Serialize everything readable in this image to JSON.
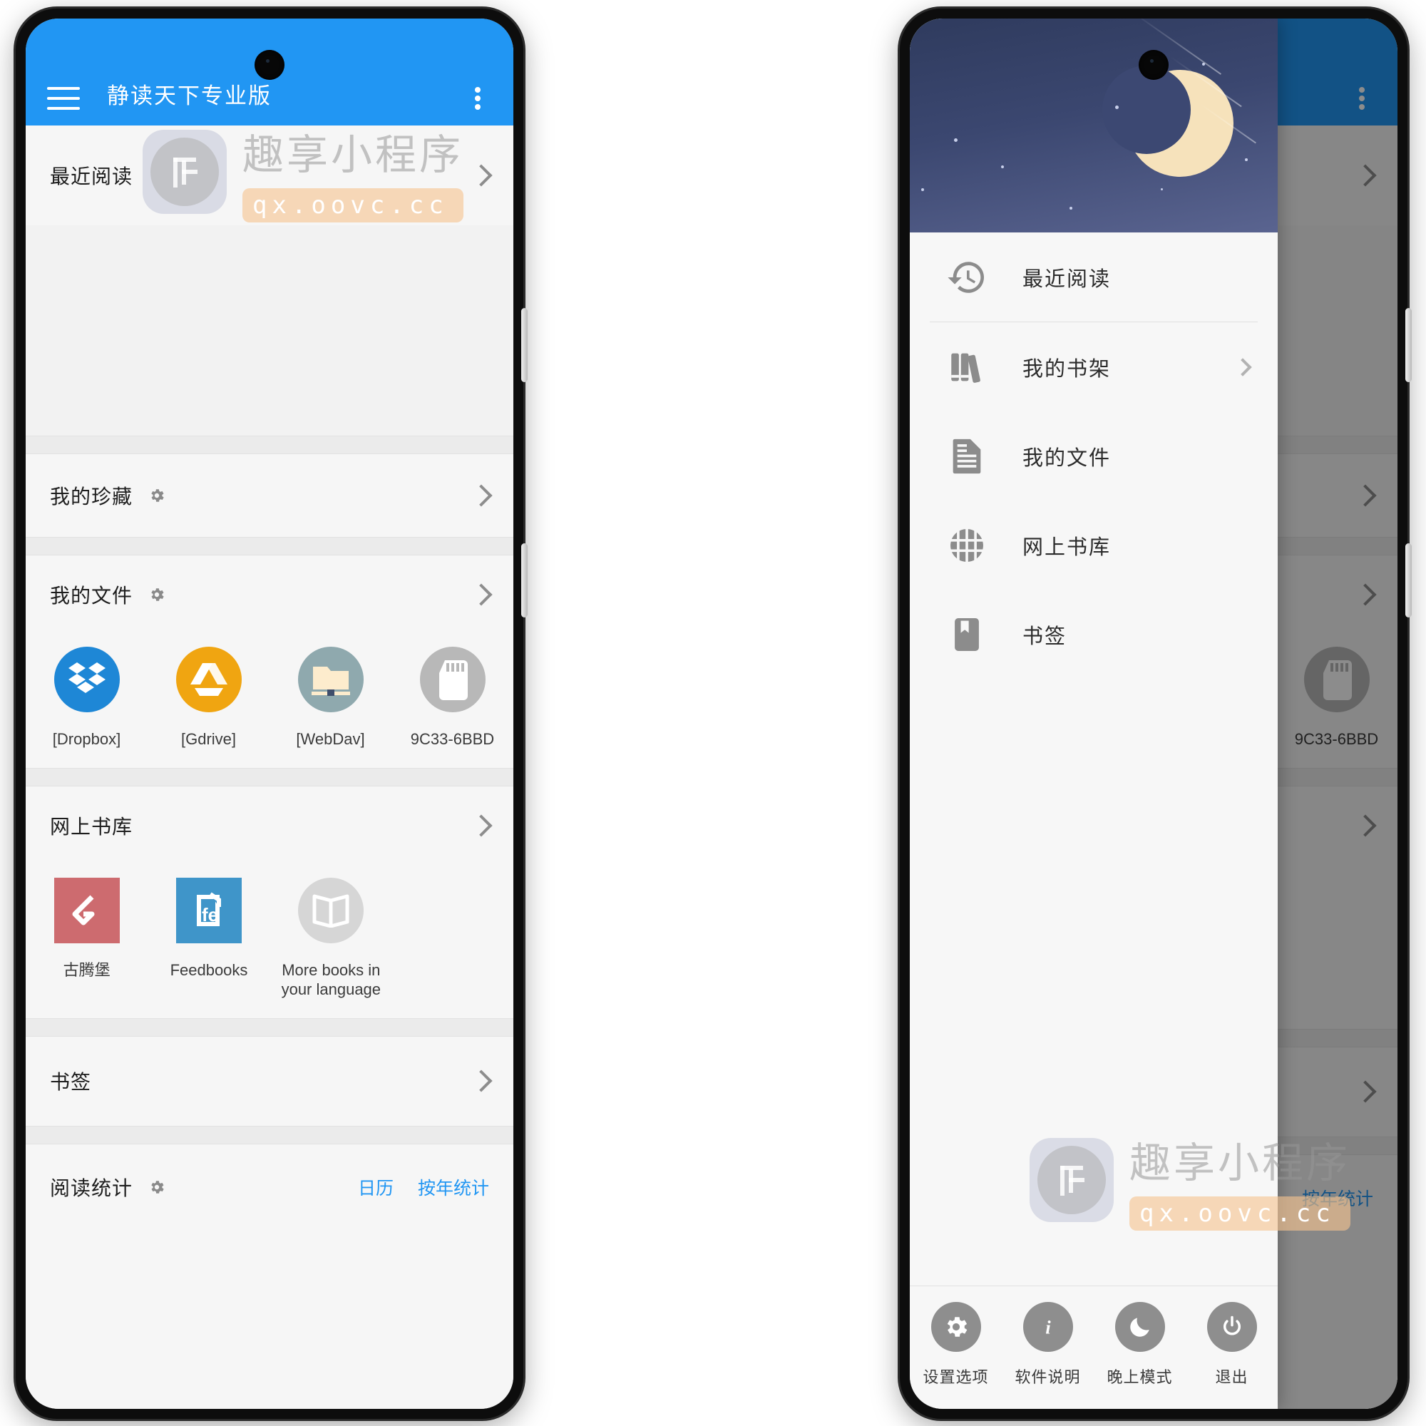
{
  "app": {
    "title": "静读天下专业版",
    "accent_color": "#2196f3"
  },
  "watermark": {
    "brand": "趣享小程序",
    "url": "qx.oovc.cc",
    "logo_glyph": "F"
  },
  "main_screen": {
    "sections": [
      {
        "name": "recent-reading",
        "title": "最近阅读",
        "has_gear": false,
        "has_chevron": true
      },
      {
        "name": "my-collection",
        "title": "我的珍藏",
        "has_gear": true,
        "has_chevron": true
      },
      {
        "name": "my-files",
        "title": "我的文件",
        "has_gear": true,
        "has_chevron": true
      },
      {
        "name": "online-library",
        "title": "网上书库",
        "has_gear": false,
        "has_chevron": true
      },
      {
        "name": "bookmarks",
        "title": "书签",
        "has_gear": false,
        "has_chevron": true
      },
      {
        "name": "reading-stats",
        "title": "阅读统计",
        "has_gear": true,
        "has_chevron": false
      }
    ],
    "file_tiles": [
      {
        "label": "[Dropbox]",
        "icon": "dropbox-icon"
      },
      {
        "label": "[Gdrive]",
        "icon": "google-drive-icon"
      },
      {
        "label": "[WebDav]",
        "icon": "webdav-folder-icon"
      },
      {
        "label": "9C33-6BBD",
        "icon": "sdcard-icon"
      }
    ],
    "library_tiles": [
      {
        "label": "古腾堡",
        "icon": "gutenberg-icon"
      },
      {
        "label": "Feedbooks",
        "icon": "feedbooks-icon"
      },
      {
        "label": "More books in your language",
        "icon": "open-book-icon"
      }
    ],
    "stats_links": [
      {
        "label": "日历",
        "name": "calendar-link"
      },
      {
        "label": "按年统计",
        "name": "yearly-stats-link"
      }
    ]
  },
  "drawer": {
    "items": [
      {
        "label": "最近阅读",
        "icon": "history-clock-icon",
        "has_chevron": false
      },
      {
        "label": "我的书架",
        "icon": "bookshelf-icon",
        "has_chevron": true
      },
      {
        "label": "我的文件",
        "icon": "document-icon",
        "has_chevron": false
      },
      {
        "label": "网上书库",
        "icon": "globe-icon",
        "has_chevron": false
      },
      {
        "label": "书签",
        "icon": "bookmark-icon",
        "has_chevron": false
      }
    ],
    "bottom_buttons": [
      {
        "label": "设置选项",
        "icon": "gear-icon"
      },
      {
        "label": "软件说明",
        "icon": "info-icon"
      },
      {
        "label": "晚上模式",
        "icon": "moon-icon"
      },
      {
        "label": "退出",
        "icon": "power-icon"
      }
    ]
  }
}
